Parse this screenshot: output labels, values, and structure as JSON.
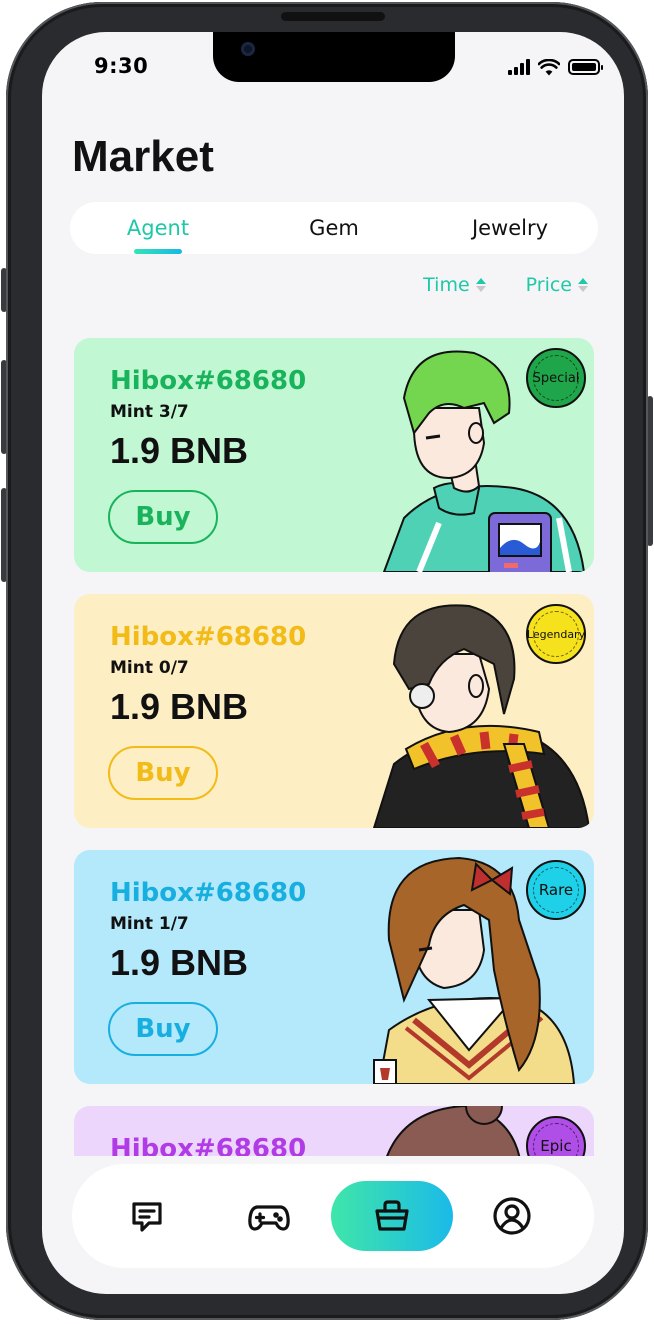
{
  "status_bar": {
    "time": "9:30"
  },
  "page_title": "Market",
  "tabs": [
    {
      "label": "Agent",
      "active": true
    },
    {
      "label": "Gem",
      "active": false
    },
    {
      "label": "Jewelry",
      "active": false
    }
  ],
  "sort": {
    "time_label": "Time",
    "price_label": "Price"
  },
  "cards": [
    {
      "name": "Hibox#68680",
      "mint": "Mint 3/7",
      "price": "1.9 BNB",
      "buy_label": "Buy",
      "rarity": "Special",
      "accent": "#19b35c",
      "bg": "#c2f7d3",
      "badge_color": "#1fa64a"
    },
    {
      "name": "Hibox#68680",
      "mint": "Mint 0/7",
      "price": "1.9 BNB",
      "buy_label": "Buy",
      "rarity": "Legendary",
      "accent": "#f2bb17",
      "bg": "#fdeec4",
      "badge_color": "#f5e11c"
    },
    {
      "name": "Hibox#68680",
      "mint": "Mint 1/7",
      "price": "1.9 BNB",
      "buy_label": "Buy",
      "rarity": "Rare",
      "accent": "#17aee0",
      "bg": "#b4e8fb",
      "badge_color": "#1ed1e8"
    },
    {
      "name": "Hibox#68680",
      "mint": "",
      "price": "",
      "buy_label": "",
      "rarity": "Epic",
      "accent": "#b13ce6",
      "bg": "#ecd6fb",
      "badge_color": "#b04ee8"
    }
  ],
  "nav": [
    {
      "icon": "chat-icon",
      "active": false
    },
    {
      "icon": "gamepad-icon",
      "active": false
    },
    {
      "icon": "basket-icon",
      "active": true
    },
    {
      "icon": "profile-icon",
      "active": false
    }
  ]
}
